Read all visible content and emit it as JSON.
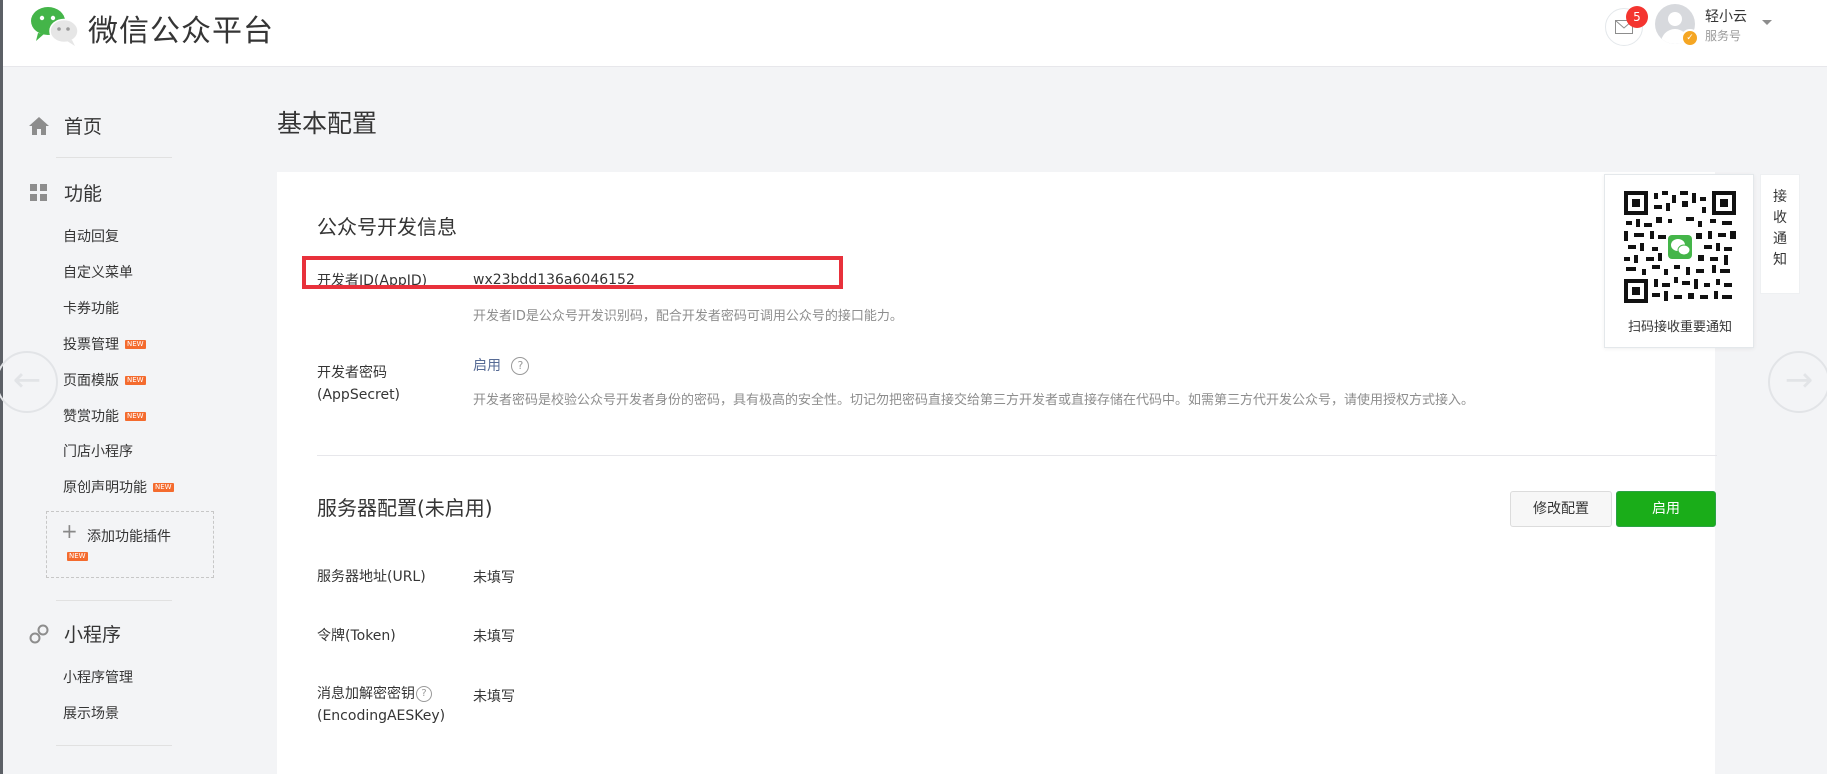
{
  "header": {
    "site_title": "微信公众平台",
    "mail_badge": "5",
    "user_name": "轻小云",
    "user_type": "服务号"
  },
  "sidebar": {
    "home": "首页",
    "function_section": "功能",
    "function_items": [
      {
        "label": "自动回复"
      },
      {
        "label": "自定义菜单"
      },
      {
        "label": "卡券功能"
      },
      {
        "label": "投票管理",
        "new": "NEW"
      },
      {
        "label": "页面模版",
        "new": "NEW"
      },
      {
        "label": "赞赏功能",
        "new": "NEW"
      },
      {
        "label": "门店小程序"
      },
      {
        "label": "原创声明功能",
        "new": "NEW"
      }
    ],
    "add_plugin": "添加功能插件",
    "add_plugin_new": "NEW",
    "mini_program_section": "小程序",
    "mini_program_items": [
      {
        "label": "小程序管理"
      },
      {
        "label": "展示场景"
      }
    ]
  },
  "main": {
    "page_title": "基本配置",
    "dev_info": {
      "title": "公众号开发信息",
      "appid_label": "开发者ID(AppID)",
      "appid_value": "wx23bdd136a6046152",
      "appid_hint": "开发者ID是公众号开发识别码，配合开发者密码可调用公众号的接口能力。",
      "secret_label_1": "开发者密码",
      "secret_label_2": "(AppSecret)",
      "secret_link": "启用",
      "secret_help": "?",
      "secret_hint": "开发者密码是校验公众号开发者身份的密码，具有极高的安全性。切记勿把密码直接交给第三方开发者或直接存储在代码中。如需第三方代开发公众号，请使用授权方式接入。"
    },
    "server_config": {
      "title": "服务器配置(未启用)",
      "modify_button": "修改配置",
      "enable_button": "启用",
      "url_label": "服务器地址(URL)",
      "url_value": "未填写",
      "token_label": "令牌(Token)",
      "token_value": "未填写",
      "aes_label_1": "消息加解密密钥",
      "aes_help": "?",
      "aes_label_2": "(EncodingAESKey)",
      "aes_value": "未填写"
    }
  },
  "qr_panel": {
    "caption": "扫码接收重要通知",
    "notice_tab": [
      "接",
      "收",
      "通",
      "知"
    ]
  },
  "colors": {
    "accent_green": "#1aad19",
    "link_blue": "#576b95",
    "highlight_red": "#e8313b",
    "badge_red": "#f43530",
    "new_tag_orange": "#f46b2e"
  }
}
